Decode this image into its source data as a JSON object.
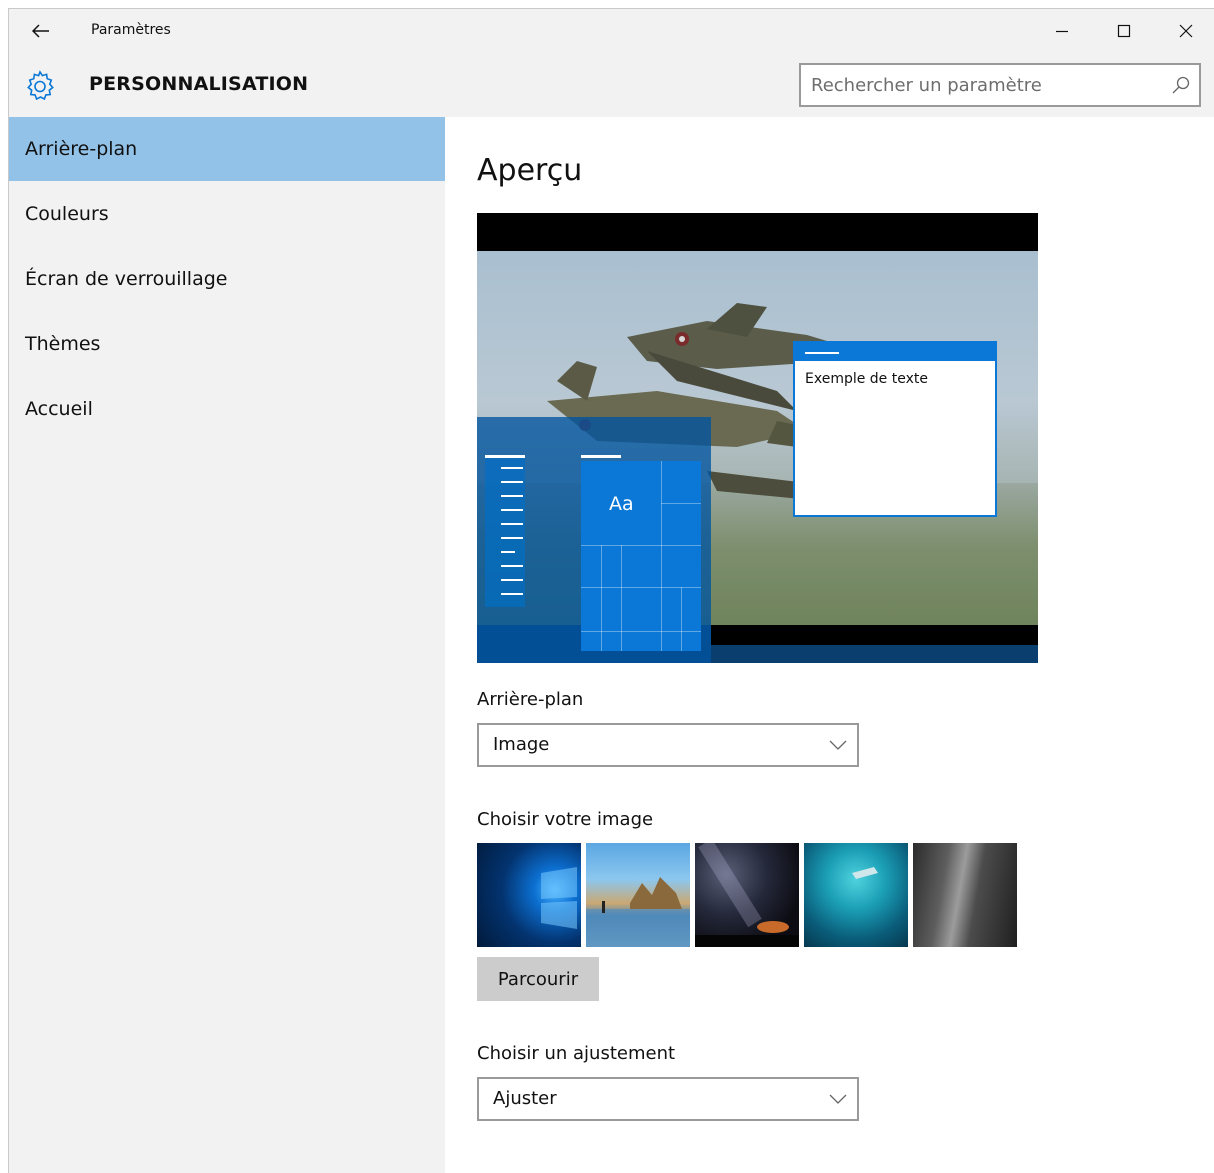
{
  "window": {
    "title": "Paramètres",
    "back_icon": "back-arrow-icon",
    "controls": [
      "minimize-icon",
      "maximize-icon",
      "close-icon"
    ]
  },
  "header": {
    "section_title": "PERSONNALISATION",
    "icon": "gear-icon",
    "search": {
      "placeholder": "Rechercher un paramètre",
      "icon": "search-icon"
    }
  },
  "sidebar": {
    "items": [
      {
        "label": "Arrière-plan",
        "active": true
      },
      {
        "label": "Couleurs",
        "active": false
      },
      {
        "label": "Écran de verrouillage",
        "active": false
      },
      {
        "label": "Thèmes",
        "active": false
      },
      {
        "label": "Accueil",
        "active": false
      }
    ],
    "active_color": "#93c2e8"
  },
  "content": {
    "preview_heading": "Aperçu",
    "preview": {
      "tile_text": "Aa",
      "sample_window_text": "Exemple de texte"
    },
    "background_label": "Arrière-plan",
    "background_value": "Image",
    "choose_image_label": "Choisir votre image",
    "thumbnails": [
      "windows-logo-wallpaper",
      "beach-rocks-wallpaper",
      "night-sky-wallpaper",
      "underwater-swimmer-wallpaper",
      "rock-cliff-wallpaper"
    ],
    "browse_button": "Parcourir",
    "fit_label": "Choisir un ajustement",
    "fit_value": "Ajuster"
  },
  "colors": {
    "accent": "#0b78d7",
    "chrome_bg": "#f2f2f2"
  }
}
